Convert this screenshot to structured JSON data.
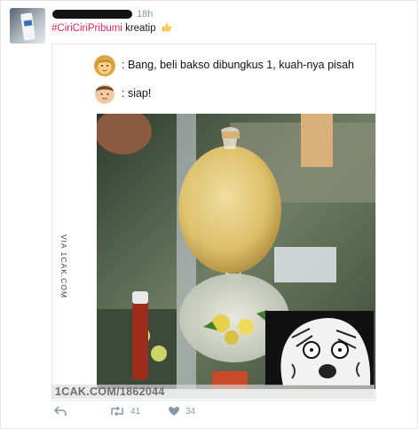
{
  "tweet": {
    "time": "18h",
    "hashtag": "#CiriCiriPribumi",
    "text": "kreatip",
    "text_emoji_icon": "thumbs-up-icon"
  },
  "meme": {
    "line1": ": Bang, beli bakso dibungkus 1, kuah-nya pisah",
    "line1_icon": "woman-face-icon",
    "line2": ": siap!",
    "line2_icon": "man-face-icon",
    "side_watermark": "VIA 1CAK.COM",
    "bottom_watermark": "1CAK.COM/1862044",
    "reaction_icon": "rage-face-icon"
  },
  "actions": {
    "retweets": "41",
    "likes": "34"
  },
  "colors": {
    "hashtag": "#e0245e",
    "action_gray": "#8899a6"
  }
}
